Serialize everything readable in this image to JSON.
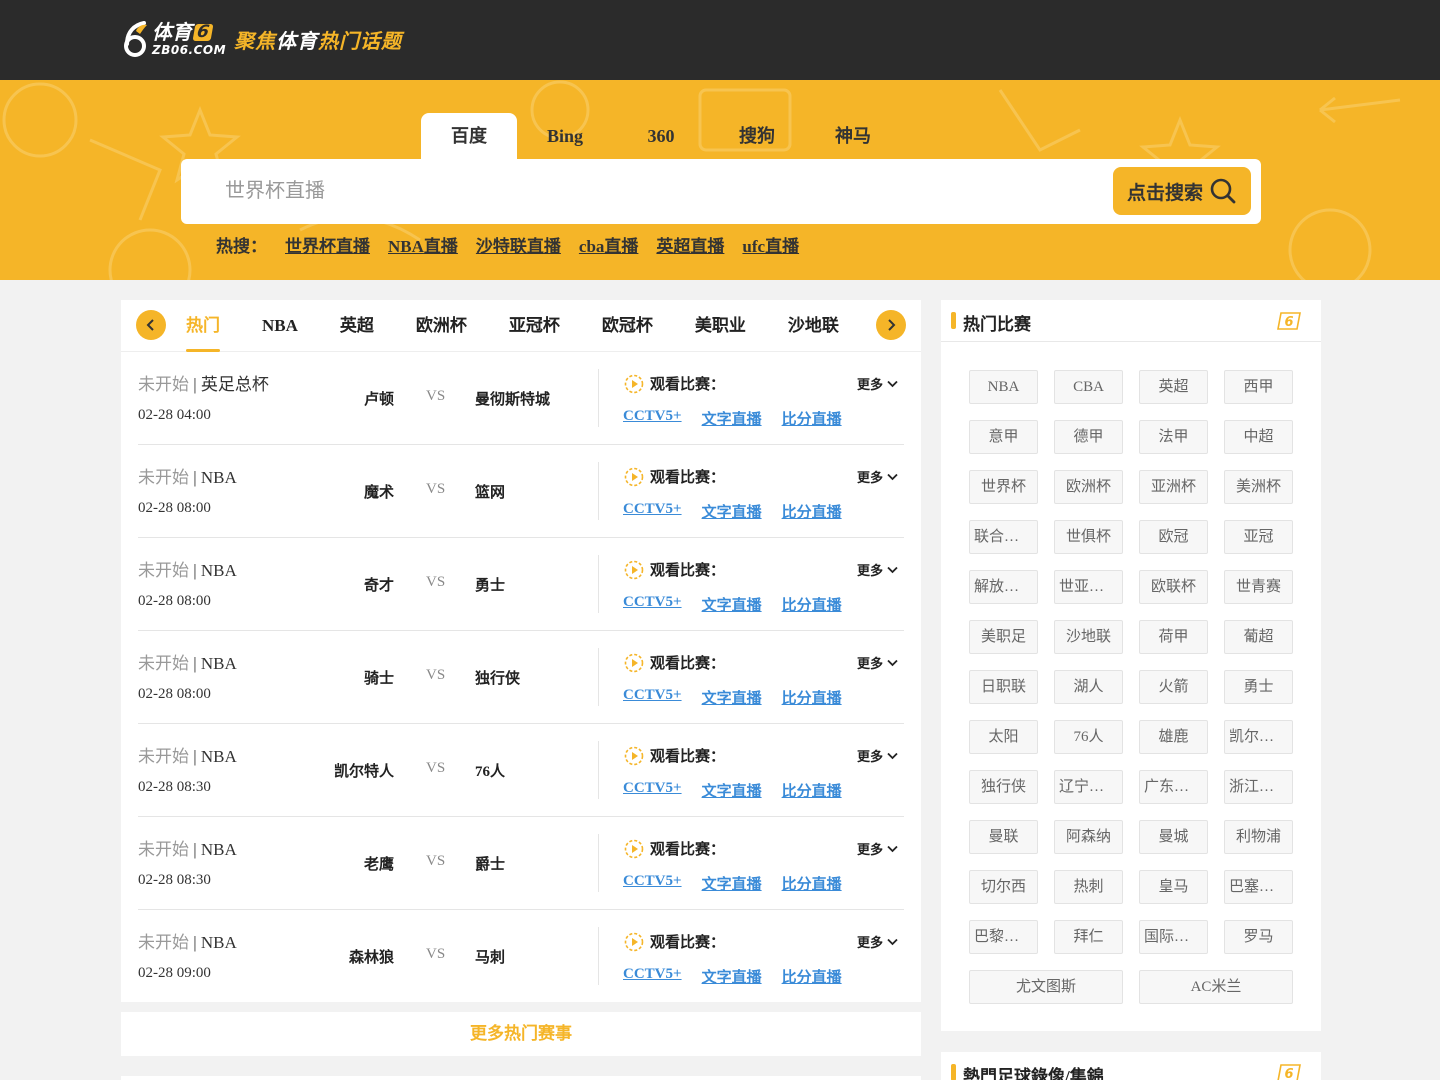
{
  "header": {
    "logo_cn": "体育",
    "logo_six": "6",
    "logo_en": "ZB06.COM",
    "slogan_a": "聚焦",
    "slogan_b": "体育",
    "slogan_c": "热门话题"
  },
  "search": {
    "engines": [
      "百度",
      "Bing",
      "360",
      "搜狗",
      "神马"
    ],
    "active_engine": "百度",
    "placeholder": "世界杯直播",
    "button_label": "点击搜索",
    "hot_label": "热搜：",
    "hot_terms": [
      "世界杯直播",
      "NBA直播",
      "沙特联直播",
      "cba直播",
      "英超直播",
      "ufc直播"
    ]
  },
  "categories": [
    "热门",
    "NBA",
    "英超",
    "欧洲杯",
    "亚冠杯",
    "欧冠杯",
    "美职业",
    "沙地联"
  ],
  "active_category": "热门",
  "match_labels": {
    "vs": "VS",
    "watch": "观看比赛：",
    "more": "更多",
    "links": [
      "CCTV5+",
      "文字直播",
      "比分直播"
    ]
  },
  "matches": [
    {
      "status": "未开始",
      "league": "英足总杯",
      "time": "02-28 04:00",
      "home": "卢顿",
      "away": "曼彻斯特城"
    },
    {
      "status": "未开始",
      "league": "NBA",
      "time": "02-28 08:00",
      "home": "魔术",
      "away": "篮网"
    },
    {
      "status": "未开始",
      "league": "NBA",
      "time": "02-28 08:00",
      "home": "奇才",
      "away": "勇士"
    },
    {
      "status": "未开始",
      "league": "NBA",
      "time": "02-28 08:00",
      "home": "骑士",
      "away": "独行侠"
    },
    {
      "status": "未开始",
      "league": "NBA",
      "time": "02-28 08:30",
      "home": "凯尔特人",
      "away": "76人"
    },
    {
      "status": "未开始",
      "league": "NBA",
      "time": "02-28 08:30",
      "home": "老鹰",
      "away": "爵士"
    },
    {
      "status": "未开始",
      "league": "NBA",
      "time": "02-28 09:00",
      "home": "森林狼",
      "away": "马刺"
    }
  ],
  "more_matches_label": "更多热门赛事",
  "hot_games": {
    "title": "热门比赛",
    "badge": "6",
    "tags": [
      "NBA",
      "CBA",
      "英超",
      "西甲",
      "意甲",
      "德甲",
      "法甲",
      "中超",
      "世界杯",
      "欧洲杯",
      "亚洲杯",
      "美洲杯",
      "联合会杯",
      "世俱杯",
      "欧冠",
      "亚冠",
      "解放者杯",
      "世亚预选",
      "欧联杯",
      "世青赛",
      "美职足",
      "沙地联",
      "荷甲",
      "葡超",
      "日职联",
      "湖人",
      "火箭",
      "勇士",
      "太阳",
      "76人",
      "雄鹿",
      "凯尔特人",
      "独行侠",
      "辽宁飞豹",
      "广东东…",
      "浙江东…",
      "曼联",
      "阿森纳",
      "曼城",
      "利物浦",
      "切尔西",
      "热刺",
      "皇马",
      "巴塞罗那",
      "巴黎圣…",
      "拜仁",
      "国际米兰",
      "罗马"
    ],
    "wide_tags": [
      "尤文图斯",
      "AC米兰"
    ]
  },
  "highlights": {
    "title": "熱門足球錄像/集錦",
    "badge": "6"
  },
  "colors": {
    "accent": "#f5b528",
    "topbar": "#2b2b2b",
    "link": "#3a8bd8"
  }
}
